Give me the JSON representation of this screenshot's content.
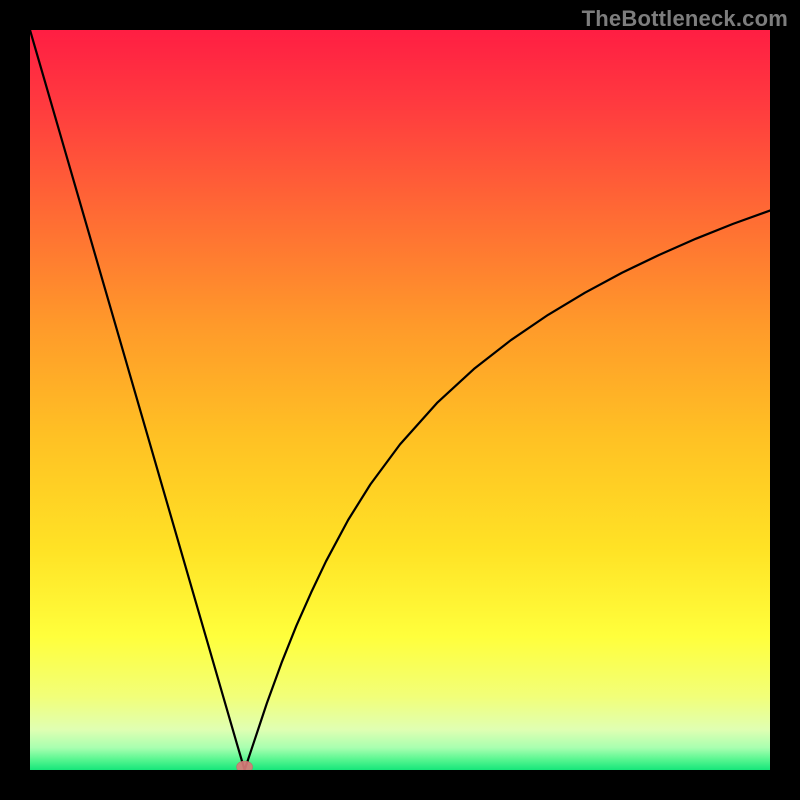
{
  "watermark": "TheBottleneck.com",
  "chart_data": {
    "type": "line",
    "title": "",
    "xlabel": "",
    "ylabel": "",
    "xlim": [
      0,
      100
    ],
    "ylim": [
      0,
      100
    ],
    "grid": false,
    "legend": false,
    "series": [
      {
        "name": "bottleneck-curve",
        "x": [
          0,
          2,
          4,
          6,
          8,
          10,
          12,
          14,
          16,
          18,
          20,
          22,
          24,
          26,
          28,
          29,
          30,
          31,
          32,
          34,
          36,
          38,
          40,
          43,
          46,
          50,
          55,
          60,
          65,
          70,
          75,
          80,
          85,
          90,
          95,
          100
        ],
        "y": [
          100,
          93.1,
          86.2,
          79.3,
          72.4,
          65.5,
          58.6,
          51.7,
          44.8,
          37.9,
          31.0,
          24.1,
          17.2,
          10.3,
          3.4,
          0.0,
          3.0,
          6.0,
          9.0,
          14.5,
          19.5,
          24.0,
          28.2,
          33.8,
          38.6,
          44.0,
          49.6,
          54.2,
          58.1,
          61.5,
          64.5,
          67.2,
          69.6,
          71.8,
          73.8,
          75.6
        ]
      }
    ],
    "marker": {
      "x": 29.0,
      "y": 0.0,
      "label": "optimum-marker"
    },
    "background_gradient": {
      "stops": [
        {
          "offset": 0.0,
          "color": "#ff1e43"
        },
        {
          "offset": 0.1,
          "color": "#ff3a3f"
        },
        {
          "offset": 0.25,
          "color": "#ff6b34"
        },
        {
          "offset": 0.4,
          "color": "#ff9a2a"
        },
        {
          "offset": 0.55,
          "color": "#ffc124"
        },
        {
          "offset": 0.7,
          "color": "#ffe225"
        },
        {
          "offset": 0.82,
          "color": "#ffff3c"
        },
        {
          "offset": 0.9,
          "color": "#f2ff78"
        },
        {
          "offset": 0.945,
          "color": "#e0ffb2"
        },
        {
          "offset": 0.97,
          "color": "#a8ffb0"
        },
        {
          "offset": 0.985,
          "color": "#5cf792"
        },
        {
          "offset": 1.0,
          "color": "#16e67a"
        }
      ]
    }
  },
  "plot_geometry": {
    "inner_x": 30,
    "inner_y": 30,
    "inner_w": 740,
    "inner_h": 740
  }
}
